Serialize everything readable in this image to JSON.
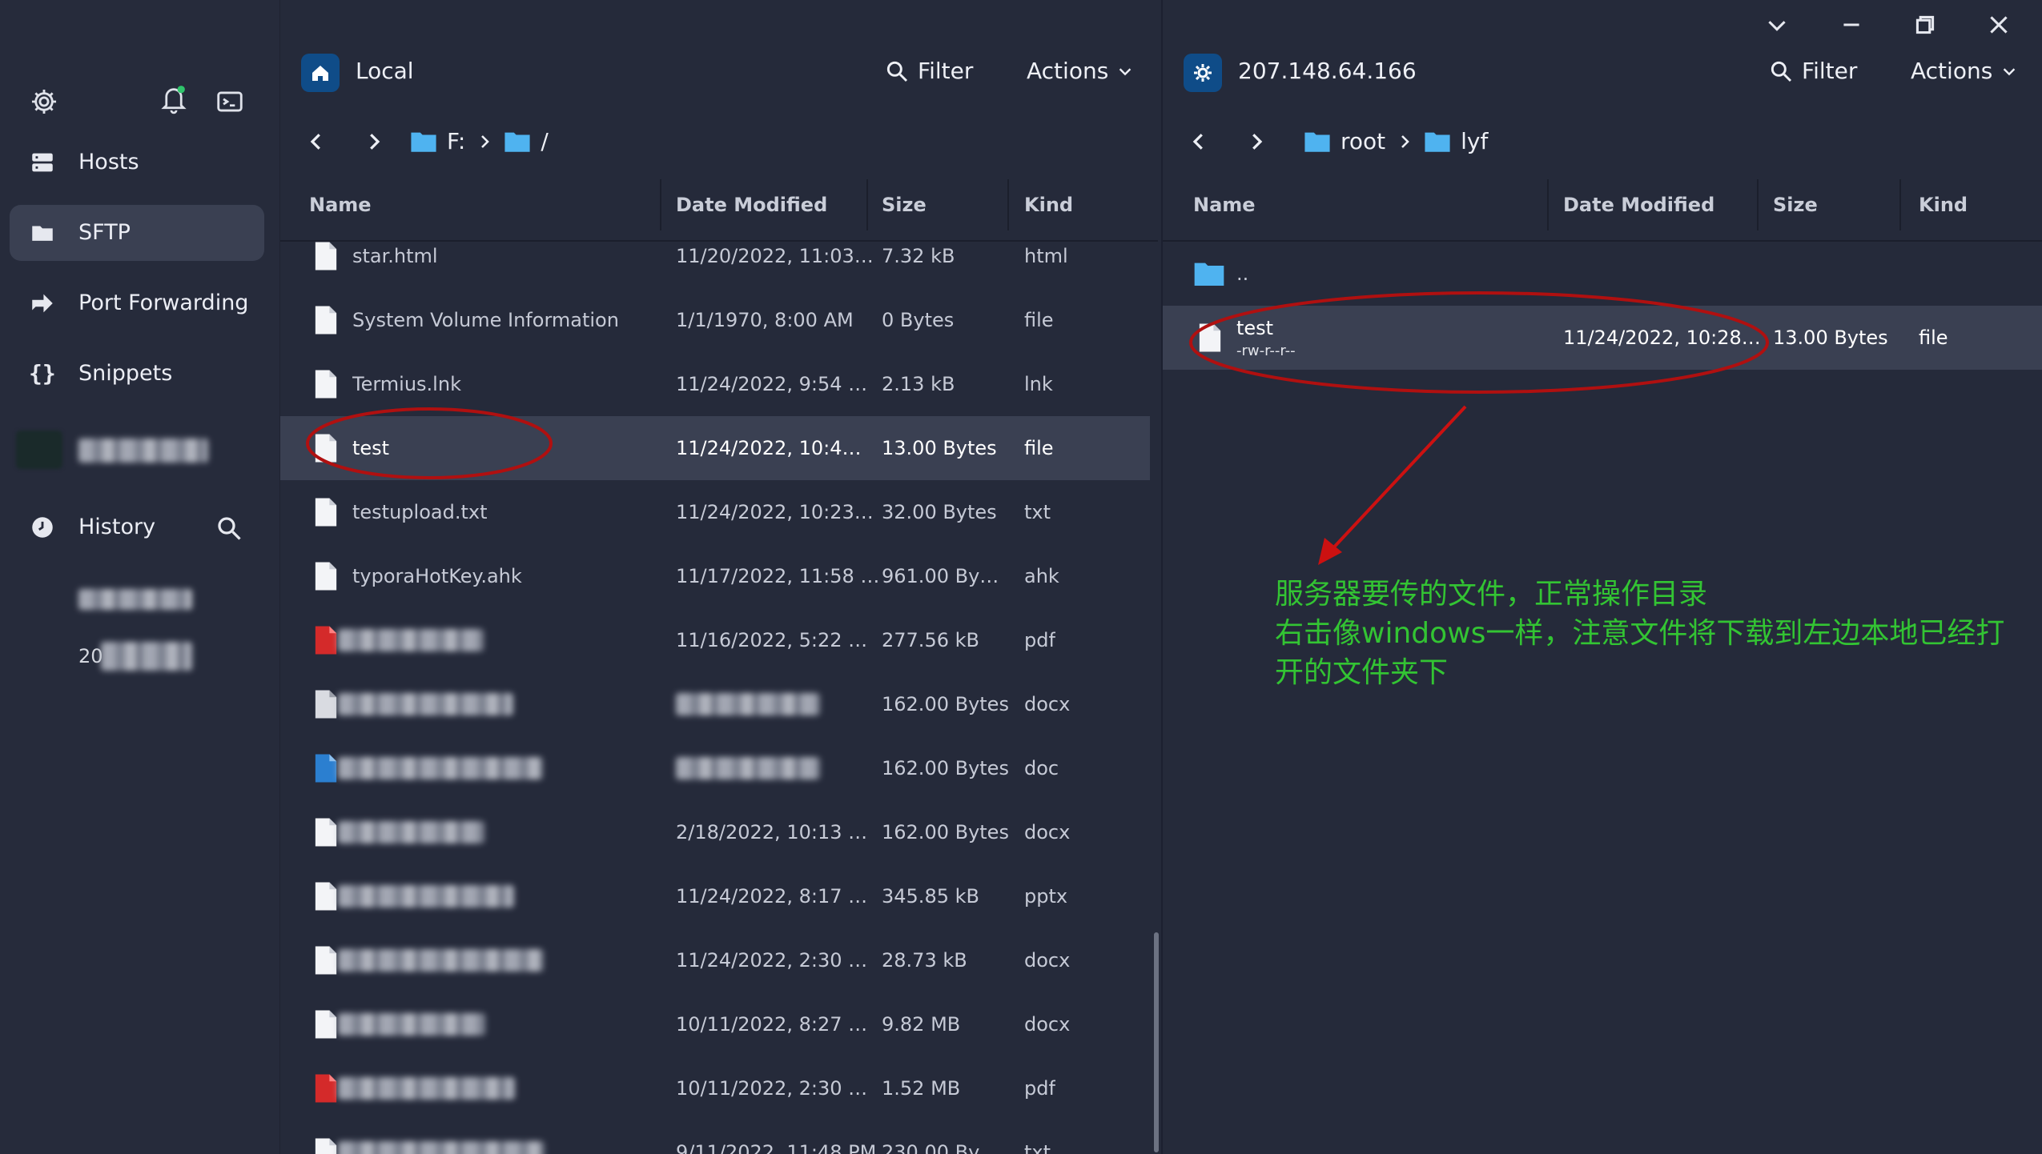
{
  "sidebar": {
    "nav": [
      {
        "label": "Hosts",
        "icon": "hosts-icon"
      },
      {
        "label": "SFTP",
        "icon": "folder-icon",
        "active": true
      },
      {
        "label": "Port Forwarding",
        "icon": "port-forward-icon"
      },
      {
        "label": "Snippets",
        "icon": "snippets-icon"
      }
    ],
    "history_label": "History",
    "partial_item_text": "20"
  },
  "left_panel": {
    "title": "Local",
    "filter_label": "Filter",
    "actions_label": "Actions",
    "breadcrumb": [
      "F:",
      "/"
    ],
    "columns": [
      "Name",
      "Date Modified",
      "Size",
      "Kind"
    ],
    "rows": [
      {
        "name": "star.html",
        "date": "11/20/2022, 11:03…",
        "size": "7.32 kB",
        "kind": "html",
        "icon": "html"
      },
      {
        "name": "System Volume Information",
        "date": "1/1/1970, 8:00 AM",
        "size": "0 Bytes",
        "kind": "file",
        "icon": "file"
      },
      {
        "name": "Termius.lnk",
        "date": "11/24/2022, 9:54 …",
        "size": "2.13 kB",
        "kind": "lnk",
        "icon": "file"
      },
      {
        "name": "test",
        "date": "11/24/2022, 10:4…",
        "size": "13.00 Bytes",
        "kind": "file",
        "icon": "file",
        "selected": true
      },
      {
        "name": "testupload.txt",
        "date": "11/24/2022, 10:23…",
        "size": "32.00 Bytes",
        "kind": "txt",
        "icon": "file"
      },
      {
        "name": "typoraHotKey.ahk",
        "date": "11/17/2022, 11:58 …",
        "size": "961.00 By…",
        "kind": "ahk",
        "icon": "file"
      },
      {
        "name": "",
        "date": "11/16/2022, 5:22 …",
        "size": "277.56 kB",
        "kind": "pdf",
        "icon": "pdf",
        "blurred": true
      },
      {
        "name": "",
        "date": "",
        "size": "162.00 Bytes",
        "kind": "docx",
        "icon": "doc-gray",
        "blurred": true
      },
      {
        "name": "",
        "date": "",
        "size": "162.00 Bytes",
        "kind": "doc",
        "icon": "doc-blue",
        "blurred": true
      },
      {
        "name": "",
        "date": "2/18/2022, 10:13 …",
        "size": "162.00 Bytes",
        "kind": "docx",
        "icon": "file",
        "blurred": true
      },
      {
        "name": "",
        "date": "11/24/2022, 8:17 …",
        "size": "345.85 kB",
        "kind": "pptx",
        "icon": "file",
        "blurred": true
      },
      {
        "name": "",
        "date": "11/24/2022, 2:30 …",
        "size": "28.73 kB",
        "kind": "docx",
        "icon": "file",
        "blurred": true
      },
      {
        "name": "",
        "date": "10/11/2022, 8:27 …",
        "size": "9.82 MB",
        "kind": "docx",
        "icon": "file",
        "blurred": true
      },
      {
        "name": "",
        "date": "10/11/2022, 2:30 …",
        "size": "1.52 MB",
        "kind": "pdf",
        "icon": "pdf",
        "blurred": true
      },
      {
        "name": "",
        "date": "9/11/2022, 11:48 PM",
        "size": "230.00 By…",
        "kind": "txt",
        "icon": "file",
        "blurred": true
      }
    ]
  },
  "right_panel": {
    "title": "207.148.64.166",
    "filter_label": "Filter",
    "actions_label": "Actions",
    "breadcrumb": [
      "root",
      "lyf"
    ],
    "columns": [
      "Name",
      "Date Modified",
      "Size",
      "Kind"
    ],
    "parent_label": "..",
    "rows": [
      {
        "name": "test",
        "permissions": "-rw-r--r--",
        "date": "11/24/2022, 10:28…",
        "size": "13.00 Bytes",
        "kind": "file",
        "selected": true
      }
    ]
  },
  "annotation": {
    "lines": [
      "服务器要传的文件，正常操作目录",
      "右击像windows一样，注意文件将下载到左边本地已经打",
      "开的文件夹下"
    ],
    "color": "#33c433",
    "mark_color": "#b01010"
  },
  "colors": {
    "background": "#252a3a",
    "selected_row": "#3a4052",
    "folder": "#4fb3f0",
    "host_badge": "#0f4c88"
  }
}
